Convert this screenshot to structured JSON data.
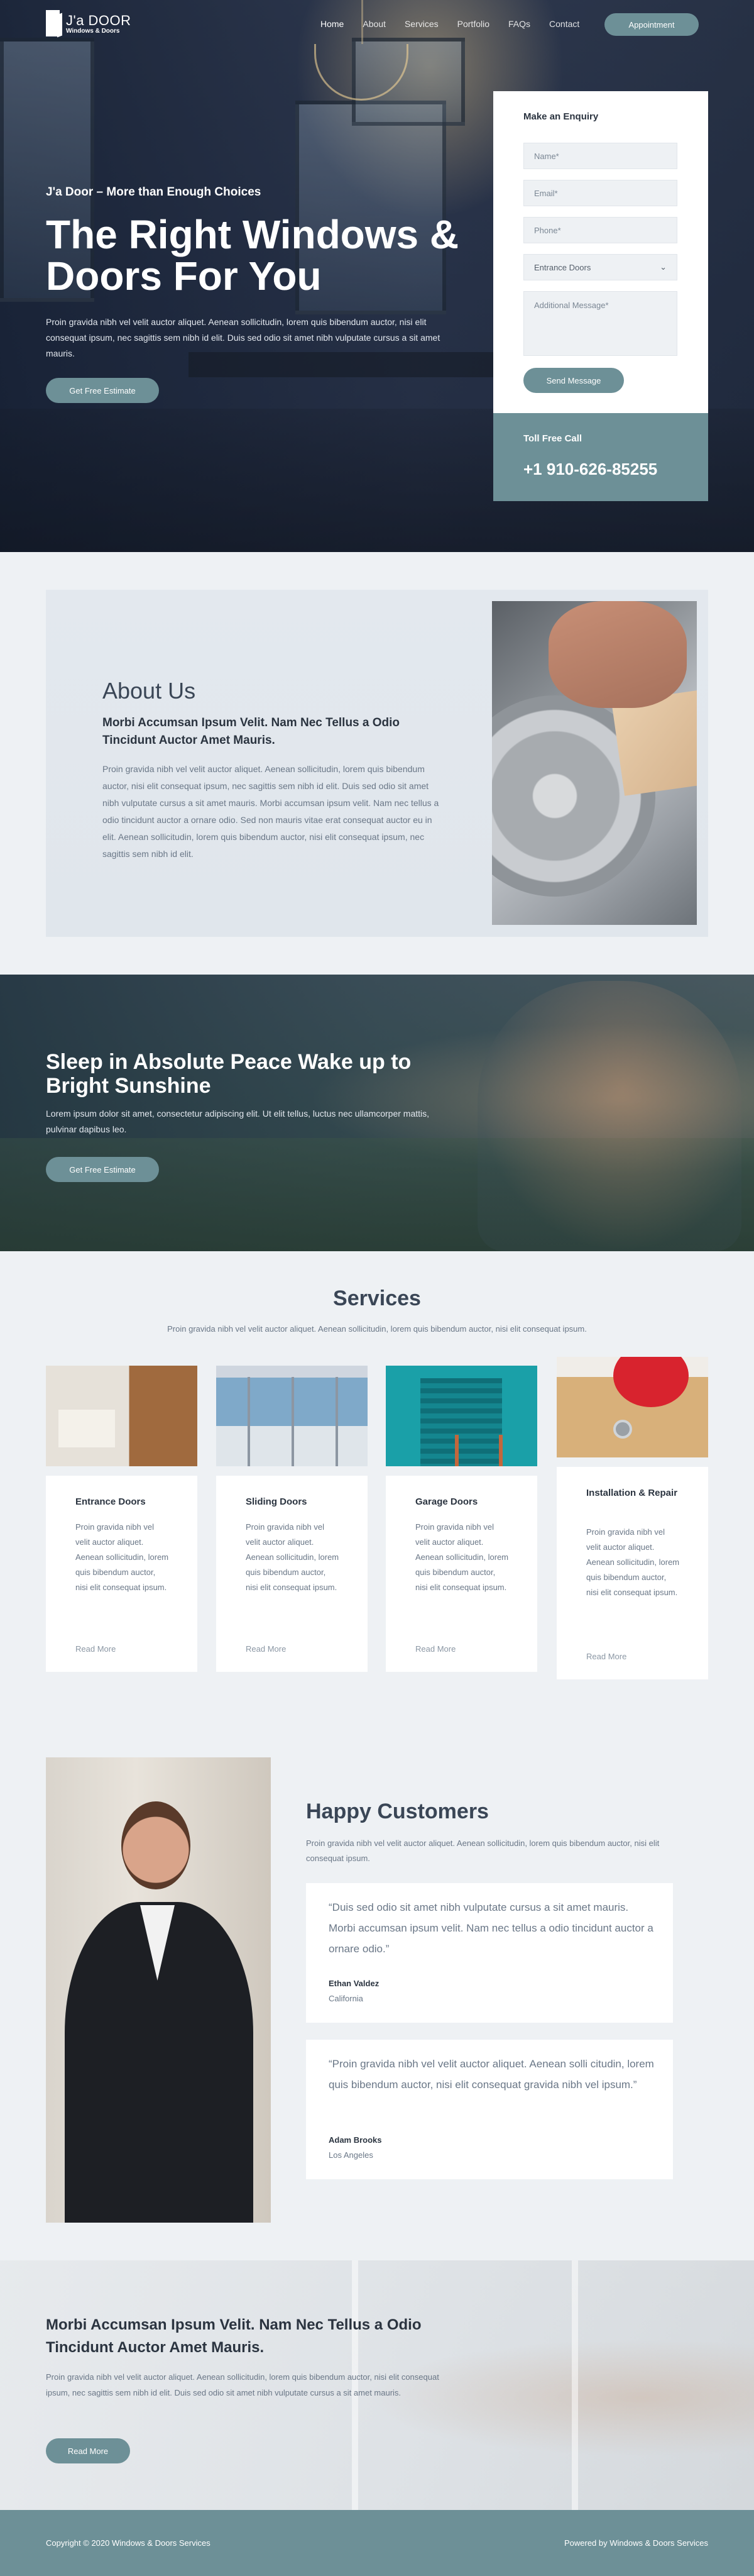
{
  "nav": {
    "brand": "J'a DOOR",
    "brand_sub": "Windows & Doors",
    "items": [
      "Home",
      "About",
      "Services",
      "Portfolio",
      "FAQs",
      "Contact"
    ],
    "cta": "Appointment"
  },
  "hero": {
    "tagline": "J'a Door – More than Enough Choices",
    "title": "The Right Windows & Doors For You",
    "text": "Proin gravida nibh vel velit auctor aliquet. Aenean sollicitudin, lorem quis bibendum auctor, nisi elit consequat ipsum, nec sagittis sem nibh id elit. Duis sed odio sit amet nibh vulputate cursus a sit amet mauris.",
    "button": "Get Free Estimate"
  },
  "enquiry": {
    "title": "Make an Enquiry",
    "name_placeholder": "Name*",
    "email_placeholder": "Email*",
    "phone_placeholder": "Phone*",
    "select_value": "Entrance Doors",
    "message_placeholder": "Additional Message*",
    "submit": "Send Message",
    "toll_label": "Toll Free Call",
    "toll_number": "+1 910-626-85255"
  },
  "about": {
    "title": "About Us",
    "subtitle": "Morbi Accumsan Ipsum Velit. Nam Nec Tellus a Odio Tincidunt Auctor Amet Mauris.",
    "text": "Proin gravida nibh vel velit auctor aliquet. Aenean sollicitudin, lorem quis bibendum auctor, nisi elit consequat ipsum, nec sagittis sem nibh id elit. Duis sed odio sit amet nibh vulputate cursus a sit amet mauris. Morbi accumsan ipsum velit. Nam nec tellus a odio tincidunt auctor a ornare odio. Sed non mauris vitae erat consequat auctor eu in elit. Aenean sollicitudin, lorem quis bibendum auctor, nisi elit consequat ipsum, nec sagittis sem nibh id elit."
  },
  "banner": {
    "title": "Sleep in Absolute Peace Wake up to Bright Sunshine",
    "text": "Lorem ipsum dolor sit amet, consectetur adipiscing elit. Ut elit tellus, luctus nec ullamcorper mattis, pulvinar dapibus leo.",
    "button": "Get Free Estimate"
  },
  "services": {
    "title": "Services",
    "text": "Proin gravida nibh vel velit auctor aliquet. Aenean sollicitudin, lorem quis bibendum auctor, nisi elit consequat ipsum.",
    "items": [
      {
        "title": "Entrance Doors",
        "text": "Proin gravida nibh vel velit auctor aliquet. Aenean sollicitudin, lorem quis bibendum auctor, nisi elit consequat ipsum.",
        "link": "Read More"
      },
      {
        "title": "Sliding Doors",
        "text": "Proin gravida nibh vel velit auctor aliquet. Aenean sollicitudin, lorem quis bibendum auctor, nisi elit consequat ipsum.",
        "link": "Read More"
      },
      {
        "title": "Garage Doors",
        "text": "Proin gravida nibh vel velit auctor aliquet. Aenean sollicitudin, lorem quis bibendum auctor, nisi elit consequat ipsum.",
        "link": "Read More"
      },
      {
        "title": "Installation & Repair",
        "text": "Proin gravida nibh vel velit auctor aliquet. Aenean sollicitudin, lorem quis bibendum auctor, nisi elit consequat ipsum.",
        "link": "Read More"
      }
    ]
  },
  "customers": {
    "title": "Happy Customers",
    "text": "Proin gravida nibh vel velit auctor aliquet. Aenean sollicitudin, lorem quis bibendum auctor, nisi elit consequat ipsum.",
    "reviews": [
      {
        "quote": "“Duis sed odio sit amet nibh vulputate cursus a sit amet mauris. Morbi accumsan ipsum velit. Nam nec tellus a odio tincidunt auctor a ornare odio.”",
        "name": "Ethan Valdez",
        "location": "California"
      },
      {
        "quote": "“Proin gravida nibh vel velit auctor aliquet. Aenean solli citudin, lorem quis bibendum auctor, nisi elit consequat gravida nibh vel ipsum.”",
        "name": "Adam Brooks",
        "location": "Los Angeles"
      }
    ]
  },
  "cta": {
    "title": "Morbi Accumsan Ipsum Velit. Nam Nec Tellus a Odio Tincidunt Auctor Amet Mauris.",
    "text": "Proin gravida nibh vel velit auctor aliquet. Aenean sollicitudin, lorem quis bibendum auctor, nisi elit consequat ipsum, nec sagittis sem nibh id elit. Duis sed odio sit amet nibh vulputate cursus a sit amet mauris.",
    "button": "Read More"
  },
  "footer": {
    "copyright": "Copyright © 2020 Windows & Doors Services",
    "powered": "Powered by Windows & Doors Services"
  },
  "colors": {
    "accent": "#6d9097",
    "dark_text": "#2b3440",
    "body_text": "#6a7787",
    "background": "#eef1f4"
  },
  "icons": [
    "door-logo-icon",
    "chevron-down-icon"
  ]
}
